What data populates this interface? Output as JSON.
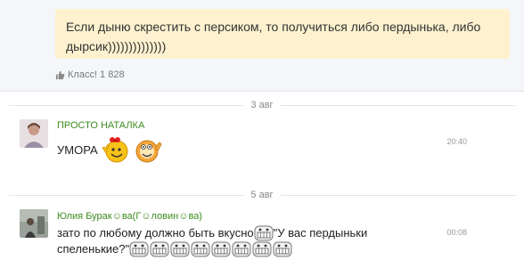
{
  "post": {
    "text": "Если дыню скрестить с персиком, то получиться либо пердынька, либо дырсик))))))))))))))",
    "like_label": "Класс! 1 828"
  },
  "separators": [
    "3 авг",
    "5 авг"
  ],
  "comments": [
    {
      "author": "ПРОСТО НАТАЛКА",
      "text": "УМОРА",
      "time": "20:40",
      "emojis": [
        "victory-smiley-icon",
        "thumbs-up-smiley-icon"
      ]
    },
    {
      "author": "Юлия Бурак☺ва(Г☺ловин☺ва)",
      "text_part1": "зато по любому должно быть  вкусно",
      "text_part2": " \"У вас пердыньки",
      "text_part3": "спеленькие?\"",
      "time": "00:08",
      "emojis": [
        "grin-teeth-icon"
      ]
    }
  ],
  "colors": {
    "author": "#3d8c1f",
    "post_bubble": "#fdf1cf"
  }
}
